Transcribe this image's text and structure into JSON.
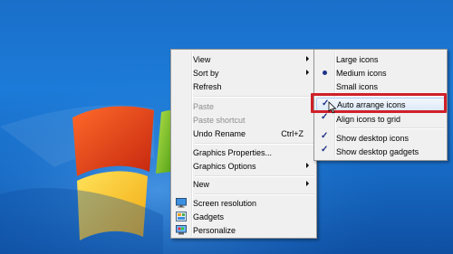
{
  "main_menu": {
    "items": [
      {
        "label": "View"
      },
      {
        "label": "Sort by"
      },
      {
        "label": "Refresh"
      },
      {
        "label": "Paste"
      },
      {
        "label": "Paste shortcut"
      },
      {
        "label": "Undo Rename",
        "shortcut": "Ctrl+Z"
      },
      {
        "label": "Graphics Properties..."
      },
      {
        "label": "Graphics Options"
      },
      {
        "label": "New"
      },
      {
        "label": "Screen resolution",
        "icon": "screen-resolution-icon"
      },
      {
        "label": "Gadgets",
        "icon": "gadgets-icon"
      },
      {
        "label": "Personalize",
        "icon": "personalize-icon"
      }
    ]
  },
  "view_submenu": {
    "items": [
      {
        "label": "Large icons"
      },
      {
        "label": "Medium icons",
        "selected": true
      },
      {
        "label": "Small icons"
      },
      {
        "label": "Auto arrange icons",
        "checked": true
      },
      {
        "label": "Align icons to grid",
        "checked": true
      },
      {
        "label": "Show desktop icons",
        "checked": true
      },
      {
        "label": "Show desktop gadgets",
        "checked": true
      }
    ]
  },
  "colors": {
    "highlight_border": "#d0202a",
    "menu_bg": "#f0f0f0",
    "desktop_blue": "#1c7bd8"
  }
}
